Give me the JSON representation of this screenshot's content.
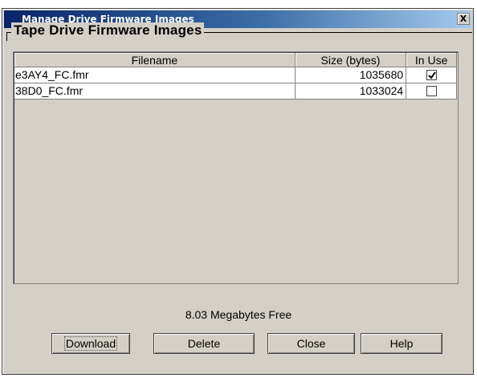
{
  "window": {
    "title": "Manage Drive Firmware Images",
    "close_label": "X"
  },
  "group": {
    "label": "Tape Drive Firmware Images"
  },
  "table": {
    "columns": [
      "Filename",
      "Size (bytes)",
      "In Use"
    ],
    "rows": [
      {
        "filename": "e3AY4_FC.fmr",
        "size": "1035680",
        "in_use": true
      },
      {
        "filename": "38D0_FC.fmr",
        "size": "1033024",
        "in_use": false
      }
    ]
  },
  "status": {
    "free_space": "8.03 Megabytes Free"
  },
  "buttons": {
    "download": "Download",
    "delete": "Delete",
    "close": "Close",
    "help": "Help"
  },
  "colors": {
    "title_bar_start": "#0a246a",
    "title_bar_end": "#a6caf0",
    "window_bg": "#d4d0c8"
  }
}
